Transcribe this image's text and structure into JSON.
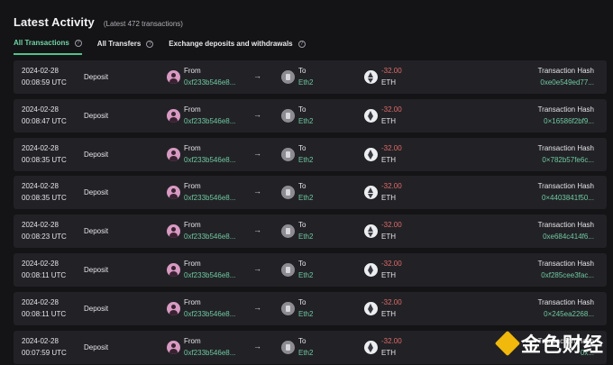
{
  "header": {
    "title": "Latest Activity",
    "subtitle": "(Latest 472 transactions)"
  },
  "tabs": [
    {
      "label": "All Transactions",
      "active": true
    },
    {
      "label": "All Transfers",
      "active": false
    },
    {
      "label": "Exchange deposits and withdrawals",
      "active": false
    }
  ],
  "help_icon_glyph": "?",
  "arrow_glyph": "→",
  "rows": [
    {
      "date": "2024-02-28",
      "time": "00:08:59 UTC",
      "type": "Deposit",
      "from_label": "From",
      "from_addr": "0xf233b546e8...",
      "to_label": "To",
      "to_name": "Eth2",
      "amount": "-32.00",
      "unit": "ETH",
      "hash_label": "Transaction Hash",
      "hash": "0xe0e549ed77..."
    },
    {
      "date": "2024-02-28",
      "time": "00:08:47 UTC",
      "type": "Deposit",
      "from_label": "From",
      "from_addr": "0xf233b546e8...",
      "to_label": "To",
      "to_name": "Eth2",
      "amount": "-32.00",
      "unit": "ETH",
      "hash_label": "Transaction Hash",
      "hash": "0×16586f2bf9..."
    },
    {
      "date": "2024-02-28",
      "time": "00:08:35 UTC",
      "type": "Deposit",
      "from_label": "From",
      "from_addr": "0xf233b546e8...",
      "to_label": "To",
      "to_name": "Eth2",
      "amount": "-32.00",
      "unit": "ETH",
      "hash_label": "Transaction Hash",
      "hash": "0×782b57fe6c..."
    },
    {
      "date": "2024-02-28",
      "time": "00:08:35 UTC",
      "type": "Deposit",
      "from_label": "From",
      "from_addr": "0xf233b546e8...",
      "to_label": "To",
      "to_name": "Eth2",
      "amount": "-32.00",
      "unit": "ETH",
      "hash_label": "Transaction Hash",
      "hash": "0×4403841f50..."
    },
    {
      "date": "2024-02-28",
      "time": "00:08:23 UTC",
      "type": "Deposit",
      "from_label": "From",
      "from_addr": "0xf233b546e8...",
      "to_label": "To",
      "to_name": "Eth2",
      "amount": "-32.00",
      "unit": "ETH",
      "hash_label": "Transaction Hash",
      "hash": "0xe684c414f6..."
    },
    {
      "date": "2024-02-28",
      "time": "00:08:11 UTC",
      "type": "Deposit",
      "from_label": "From",
      "from_addr": "0xf233b546e8...",
      "to_label": "To",
      "to_name": "Eth2",
      "amount": "-32.00",
      "unit": "ETH",
      "hash_label": "Transaction Hash",
      "hash": "0xf285cee3fac..."
    },
    {
      "date": "2024-02-28",
      "time": "00:08:11 UTC",
      "type": "Deposit",
      "from_label": "From",
      "from_addr": "0xf233b546e8...",
      "to_label": "To",
      "to_name": "Eth2",
      "amount": "-32.00",
      "unit": "ETH",
      "hash_label": "Transaction Hash",
      "hash": "0×245ea2268..."
    },
    {
      "date": "2024-02-28",
      "time": "00:07:59 UTC",
      "type": "Deposit",
      "from_label": "From",
      "from_addr": "0xf233b546e8...",
      "to_label": "To",
      "to_name": "Eth2",
      "amount": "-32.00",
      "unit": "ETH",
      "hash_label": "Transaction Hash",
      "hash": "0x..."
    }
  ],
  "watermark": {
    "text": "金色财经"
  },
  "colors": {
    "background": "#141416",
    "row": "#222226",
    "accent": "#6fd3a4",
    "negative": "#e06a68"
  }
}
